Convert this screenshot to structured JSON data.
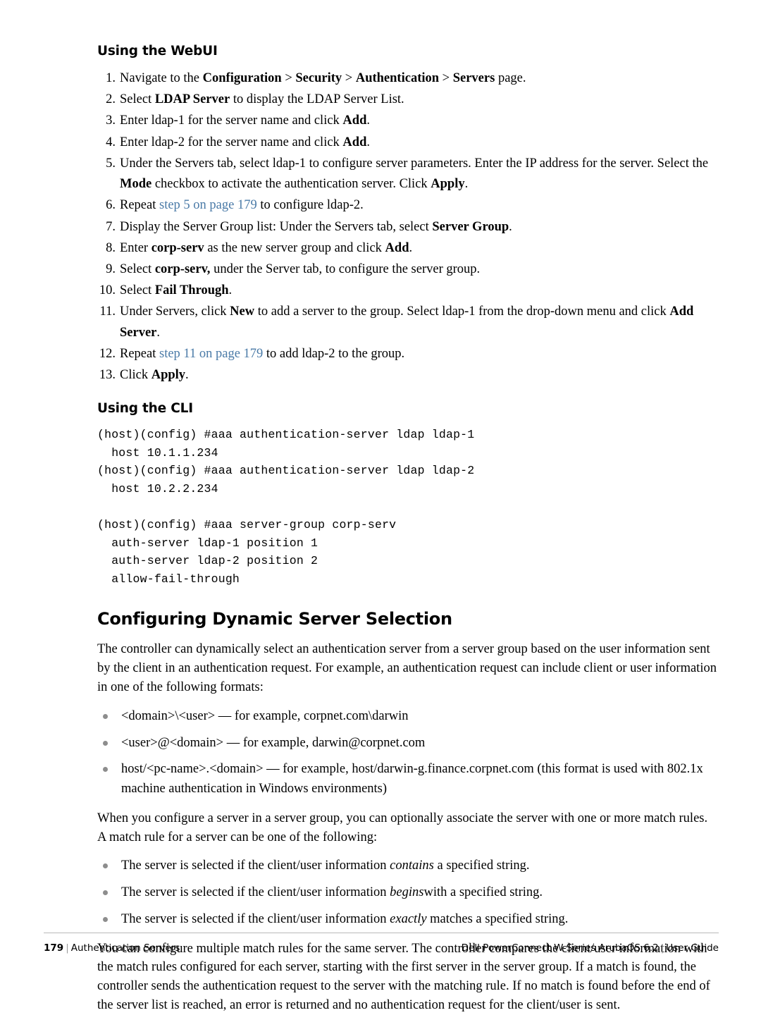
{
  "document": {
    "sections": [
      {
        "heading": "Using the WebUI",
        "steps": [
          {
            "num": "1.",
            "parts": [
              {
                "t": "Navigate to the ",
                "s": "plain"
              },
              {
                "t": "Configuration",
                "s": "bold"
              },
              {
                "t": " > ",
                "s": "plain"
              },
              {
                "t": "Security",
                "s": "bold"
              },
              {
                "t": " > ",
                "s": "plain"
              },
              {
                "t": "Authentication",
                "s": "bold"
              },
              {
                "t": " > ",
                "s": "plain"
              },
              {
                "t": "Servers",
                "s": "bold"
              },
              {
                "t": " page.",
                "s": "plain"
              }
            ]
          },
          {
            "num": "2.",
            "parts": [
              {
                "t": "Select ",
                "s": "plain"
              },
              {
                "t": "LDAP Server",
                "s": "bold"
              },
              {
                "t": " to display the LDAP Server List.",
                "s": "plain"
              }
            ]
          },
          {
            "num": "3.",
            "parts": [
              {
                "t": "Enter ldap-1 for the server name and click ",
                "s": "plain"
              },
              {
                "t": "Add",
                "s": "bold"
              },
              {
                "t": ".",
                "s": "plain"
              }
            ]
          },
          {
            "num": "4.",
            "parts": [
              {
                "t": "Enter ldap-2 for the server name and click ",
                "s": "plain"
              },
              {
                "t": "Add",
                "s": "bold"
              },
              {
                "t": ".",
                "s": "plain"
              }
            ]
          },
          {
            "num": "5.",
            "parts": [
              {
                "t": "Under the Servers tab, select ldap-1 to configure server parameters. Enter the IP address for the server. Select the ",
                "s": "plain"
              },
              {
                "t": "Mode",
                "s": "bold"
              },
              {
                "t": " checkbox to activate the authentication server. Click ",
                "s": "plain"
              },
              {
                "t": "Apply",
                "s": "bold"
              },
              {
                "t": ".",
                "s": "plain"
              }
            ]
          },
          {
            "num": "6.",
            "parts": [
              {
                "t": "Repeat ",
                "s": "plain"
              },
              {
                "t": "step 5 on page 179",
                "s": "link"
              },
              {
                "t": " to configure ldap-2.",
                "s": "plain"
              }
            ]
          },
          {
            "num": "7.",
            "parts": [
              {
                "t": "Display the Server Group list: Under the Servers tab, select ",
                "s": "plain"
              },
              {
                "t": "Server Group",
                "s": "bold"
              },
              {
                "t": ".",
                "s": "plain"
              }
            ]
          },
          {
            "num": "8.",
            "parts": [
              {
                "t": "Enter ",
                "s": "plain"
              },
              {
                "t": "corp-serv",
                "s": "bold"
              },
              {
                "t": " as the new server group and click ",
                "s": "plain"
              },
              {
                "t": "Add",
                "s": "bold"
              },
              {
                "t": ".",
                "s": "plain"
              }
            ]
          },
          {
            "num": "9.",
            "parts": [
              {
                "t": "Select ",
                "s": "plain"
              },
              {
                "t": "corp-serv,",
                "s": "bold"
              },
              {
                "t": " under the Server tab, to configure the server group.",
                "s": "plain"
              }
            ]
          },
          {
            "num": "10.",
            "parts": [
              {
                "t": "Select ",
                "s": "plain"
              },
              {
                "t": "Fail Through",
                "s": "bold"
              },
              {
                "t": ".",
                "s": "plain"
              }
            ]
          },
          {
            "num": "11.",
            "parts": [
              {
                "t": "Under Servers, click ",
                "s": "plain"
              },
              {
                "t": "New",
                "s": "bold"
              },
              {
                "t": " to add a server to the group. Select ldap-1 from the drop-down menu and click ",
                "s": "plain"
              },
              {
                "t": "Add Server",
                "s": "bold"
              },
              {
                "t": ".",
                "s": "plain"
              }
            ]
          },
          {
            "num": "12.",
            "parts": [
              {
                "t": "Repeat ",
                "s": "plain"
              },
              {
                "t": "step 11 on page 179",
                "s": "link"
              },
              {
                "t": " to add ldap-2 to the group.",
                "s": "plain"
              }
            ]
          },
          {
            "num": "13.",
            "parts": [
              {
                "t": "Click ",
                "s": "plain"
              },
              {
                "t": "Apply",
                "s": "bold"
              },
              {
                "t": ".",
                "s": "plain"
              }
            ]
          }
        ]
      }
    ],
    "cli_section": {
      "heading": "Using the CLI",
      "code": "(host)(config) #aaa authentication-server ldap ldap-1\n  host 10.1.1.234\n(host)(config) #aaa authentication-server ldap ldap-2\n  host 10.2.2.234\n\n(host)(config) #aaa server-group corp-serv\n  auth-server ldap-1 position 1\n  auth-server ldap-2 position 2\n  allow-fail-through"
    },
    "chapter": {
      "heading": "Configuring Dynamic Server Selection",
      "intro": "The controller can dynamically select an authentication server from a server group based on the user information sent by the client in an authentication request. For example, an authentication request can include client or user information in one of the following formats:",
      "format_bullets": [
        {
          "parts": [
            {
              "t": "<domain>\\<user> — for example, corpnet.com\\darwin",
              "s": "plain"
            }
          ]
        },
        {
          "parts": [
            {
              "t": "<user>@<domain> — for example, darwin@corpnet.com",
              "s": "plain"
            }
          ]
        },
        {
          "parts": [
            {
              "t": "host/<pc-name>.<domain> — for example, host/darwin-g.finance.corpnet.com (this format is used with 802.1x machine authentication in Windows environments)",
              "s": "plain"
            }
          ]
        }
      ],
      "match_intro": "When you configure a server in a server group, you can optionally associate the server with one or more match rules. A match rule for a server can be one of the following:",
      "match_bullets": [
        {
          "parts": [
            {
              "t": "The server is selected if the client/user information ",
              "s": "plain"
            },
            {
              "t": "contains",
              "s": "italic"
            },
            {
              "t": " a specified string.",
              "s": "plain"
            }
          ]
        },
        {
          "parts": [
            {
              "t": "The server is selected if the client/user information ",
              "s": "plain"
            },
            {
              "t": "begins",
              "s": "italic"
            },
            {
              "t": "with a specified string.",
              "s": "plain"
            }
          ]
        },
        {
          "parts": [
            {
              "t": "The server is selected if the client/user information ",
              "s": "plain"
            },
            {
              "t": "exactly",
              "s": "italic"
            },
            {
              "t": " matches a specified string.",
              "s": "plain"
            }
          ]
        }
      ],
      "closing": "You can configure multiple match rules for the same server. The controller compares the client/user information with the match rules configured for each server, starting with the first server in the server group. If a match is found, the controller sends the authentication request to the server with the matching rule. If no match is found before the end of the server list is reached, an error is returned and no authentication request for the client/user is sent."
    }
  },
  "footer": {
    "page_number": "179",
    "chapter_title": "Authentication Servers",
    "product_line": "Dell PowerConnect W-Series ArubaOS 6.2",
    "doc_type": "User Guide",
    "separator": "|"
  }
}
